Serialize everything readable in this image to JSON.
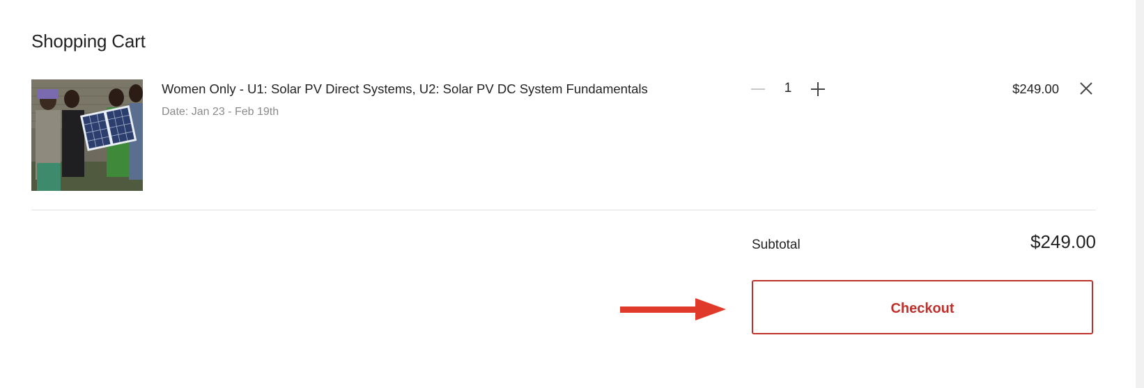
{
  "cart": {
    "title": "Shopping Cart",
    "items": [
      {
        "title": "Women Only - U1: Solar PV Direct Systems, U2: Solar PV DC System Fundamentals",
        "date": "Date: Jan 23 - Feb 19th",
        "quantity": "1",
        "price": "$249.00",
        "image_icon": "product-photo-solar-panel"
      }
    ]
  },
  "summary": {
    "subtotal_label": "Subtotal",
    "subtotal_value": "$249.00",
    "checkout_label": "Checkout"
  },
  "colors": {
    "accent": "#c0302b",
    "annotation_arrow": "#e03a2b"
  }
}
